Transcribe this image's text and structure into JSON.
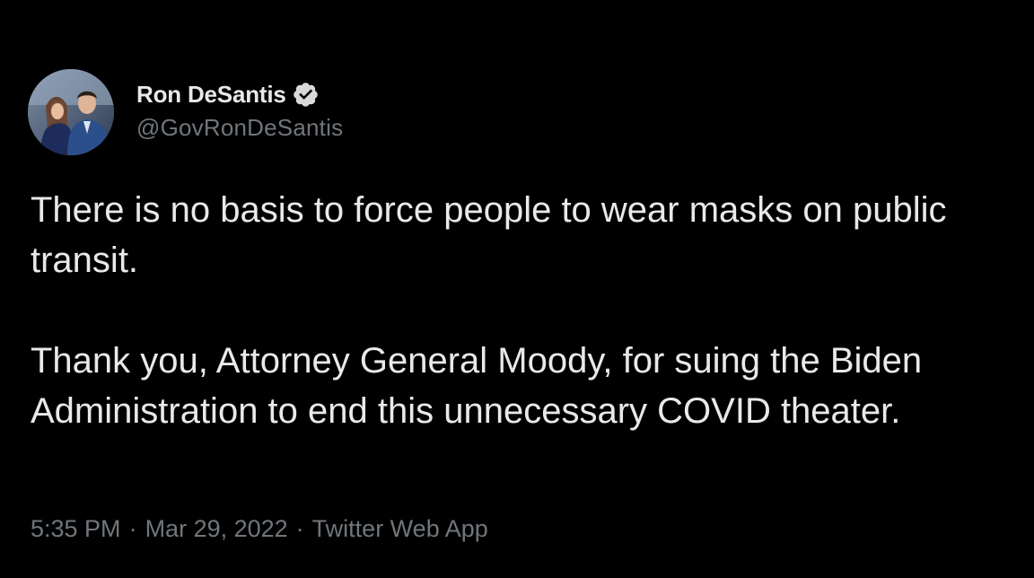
{
  "author": {
    "display_name": "Ron DeSantis",
    "handle": "@GovRonDeSantis",
    "verified": true
  },
  "tweet": {
    "paragraph1": "There is no basis to force people to wear masks on public transit.",
    "paragraph2": "Thank you, Attorney General Moody, for suing the Biden Administration to end this unnecessary COVID theater."
  },
  "meta": {
    "time": "5:35 PM",
    "separator": "·",
    "date": "Mar 29, 2022",
    "source": "Twitter Web App"
  },
  "colors": {
    "background": "#000000",
    "text_primary": "#e7e9ea",
    "text_secondary": "#71767b",
    "verified_badge": "#d9d9d9"
  },
  "icons": {
    "avatar": "profile-photo",
    "badge": "verified-badge-icon"
  }
}
